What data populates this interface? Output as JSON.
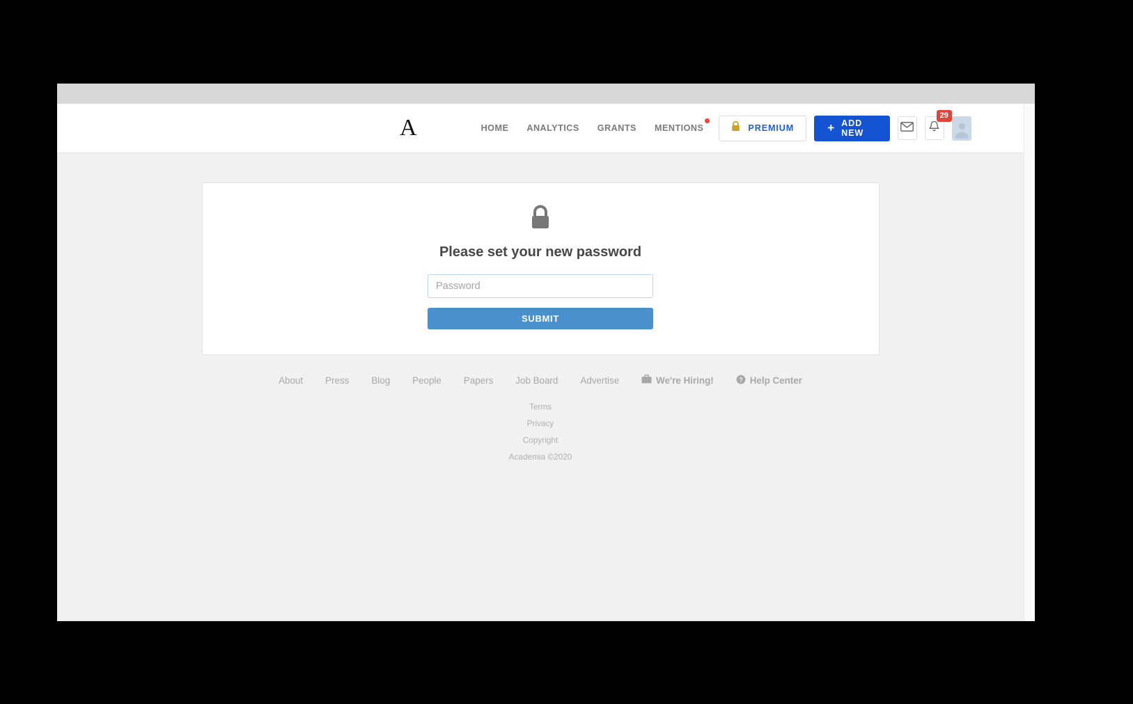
{
  "brand": {
    "logo_text": "A"
  },
  "nav": {
    "links": [
      {
        "label": "HOME",
        "dot": false
      },
      {
        "label": "ANALYTICS",
        "dot": false
      },
      {
        "label": "GRANTS",
        "dot": false
      },
      {
        "label": "MENTIONS",
        "dot": true
      }
    ],
    "premium_label": "PREMIUM",
    "premium_icon": "lock-icon",
    "premium_color": "#1c5fd6",
    "add_new_label": "ADD NEW",
    "add_new_icon": "plus-icon",
    "add_new_color": "#1453d2",
    "messages_icon": "envelope-icon",
    "notifications_icon": "bell-icon",
    "notifications_count": "29",
    "badge_color": "#e0453b",
    "avatar_icon": "user-avatar-icon"
  },
  "card": {
    "lock_icon": "lock-icon",
    "title": "Please set your new password",
    "password_placeholder": "Password",
    "password_value": "",
    "submit_label": "SUBMIT",
    "submit_color": "#4a90cd"
  },
  "footer": {
    "links": [
      {
        "label": "About",
        "icon": ""
      },
      {
        "label": "Press",
        "icon": ""
      },
      {
        "label": "Blog",
        "icon": ""
      },
      {
        "label": "People",
        "icon": ""
      },
      {
        "label": "Papers",
        "icon": ""
      },
      {
        "label": "Job Board",
        "icon": ""
      },
      {
        "label": "Advertise",
        "icon": ""
      }
    ],
    "hiring_label": "We're Hiring!",
    "hiring_icon": "briefcase-icon",
    "help_label": "Help Center",
    "help_icon": "question-circle-icon",
    "terms": "Terms",
    "privacy": "Privacy",
    "copyright_link": "Copyright",
    "copyright": "Academia ©2020"
  }
}
